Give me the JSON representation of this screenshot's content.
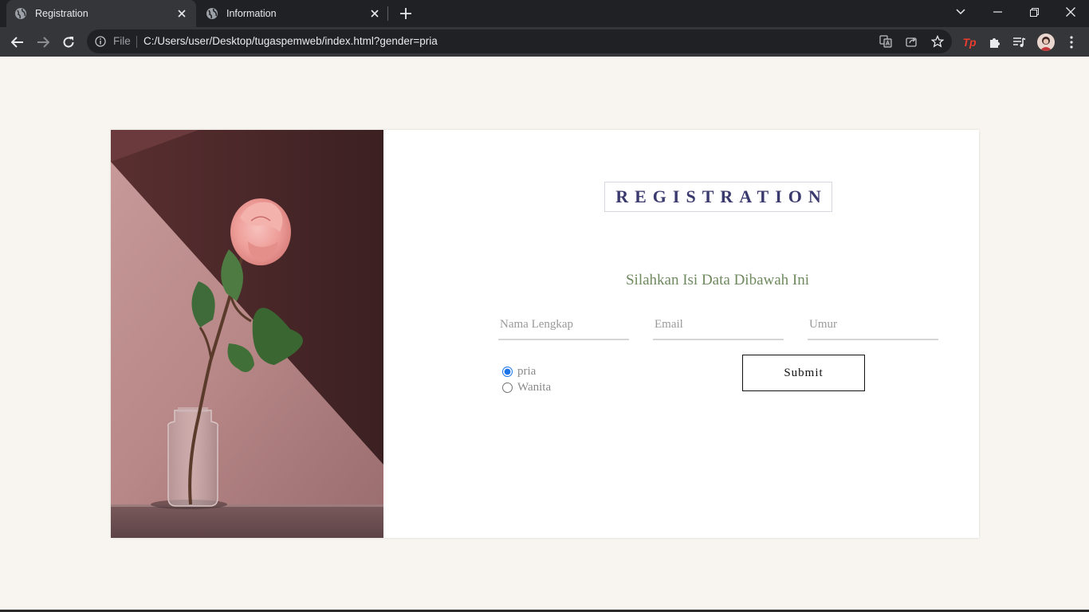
{
  "browser": {
    "tabs": [
      {
        "title": "Registration",
        "icon": "globe-icon",
        "active": true
      },
      {
        "title": "Information",
        "icon": "globe-icon",
        "active": false
      }
    ],
    "address": {
      "scheme_label": "File",
      "url": "C:/Users/user/Desktop/tugaspemweb/index.html?gender=pria"
    },
    "extensions": {
      "tp_label": "Tp"
    }
  },
  "page": {
    "background_color": "#f8f5f0",
    "title": "REGISTRATION",
    "subtitle": "Silahkan Isi Data Dibawah Ini",
    "fields": {
      "name_placeholder": "Nama Lengkap",
      "email_placeholder": "Email",
      "age_placeholder": "Umur"
    },
    "gender": {
      "options": [
        "pria",
        "Wanita"
      ],
      "selected": "pria"
    },
    "submit_label": "Submit",
    "colors": {
      "title": "#3b3a6e",
      "subtitle": "#6f8a5f",
      "radio_accent": "#1a73e8"
    }
  }
}
